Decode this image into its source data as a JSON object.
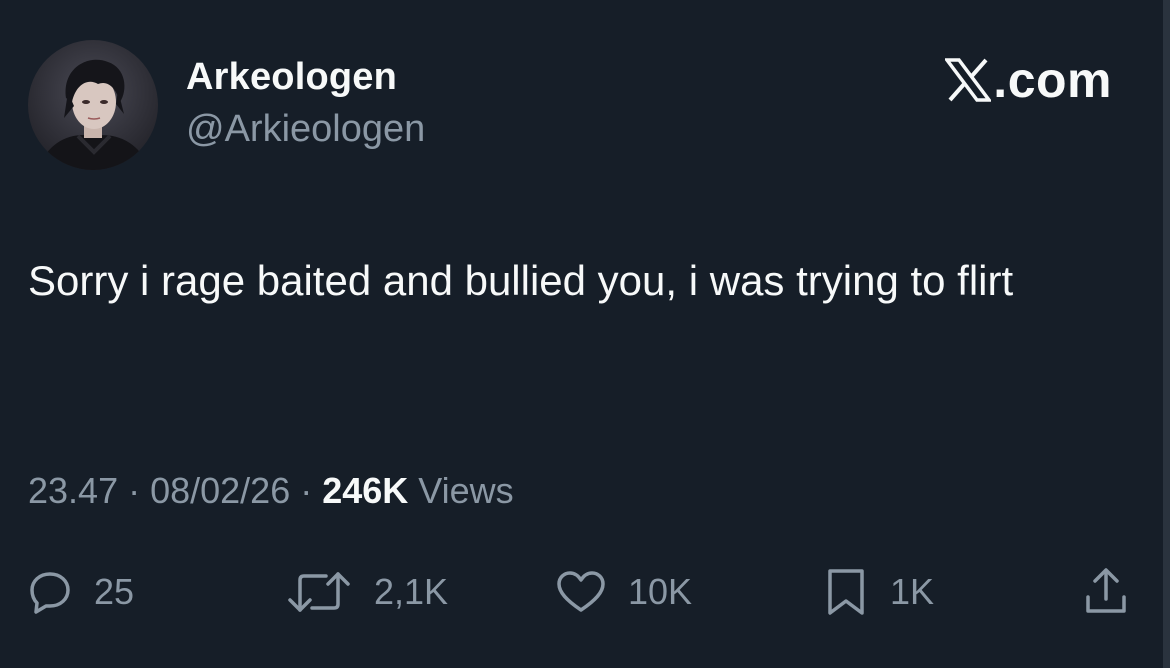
{
  "author": {
    "display_name": "Arkeologen",
    "handle": "@Arkieologen"
  },
  "brand": {
    "text": ".com",
    "logo_icon": "x-logo-icon"
  },
  "tweet": {
    "text": "Sorry i rage baited and bullied you, i was trying to flirt"
  },
  "meta": {
    "time": "23.47",
    "sep1": " · ",
    "date": "08/02/26",
    "sep2": " · ",
    "views_count": "246K",
    "views_label": " Views"
  },
  "actions": {
    "reply": {
      "icon": "reply-icon",
      "count": "25"
    },
    "retweet": {
      "icon": "retweet-icon",
      "count": "2,1K"
    },
    "like": {
      "icon": "heart-icon",
      "count": "10K"
    },
    "bookmark": {
      "icon": "bookmark-icon",
      "count": "1K"
    },
    "share": {
      "icon": "share-icon"
    }
  },
  "colors": {
    "background": "#161e28",
    "primary_text": "#f7f9f9",
    "secondary_text": "#8b98a5"
  }
}
